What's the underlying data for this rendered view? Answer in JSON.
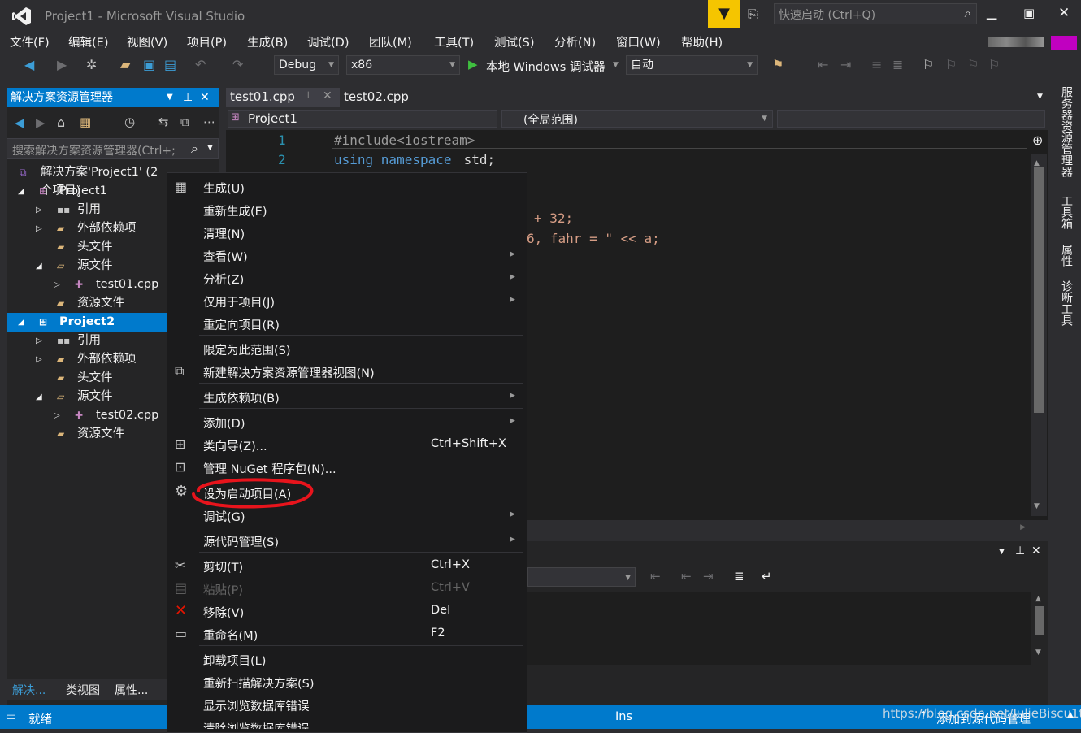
{
  "window": {
    "title": "Project1 - Microsoft Visual Studio",
    "quick_launch": "快速启动 (Ctrl+Q)"
  },
  "menu": [
    "文件(F)",
    "编辑(E)",
    "视图(V)",
    "项目(P)",
    "生成(B)",
    "调试(D)",
    "团队(M)",
    "工具(T)",
    "测试(S)",
    "分析(N)",
    "窗口(W)",
    "帮助(H)"
  ],
  "toolbar": {
    "config": "Debug",
    "platform": "x86",
    "debugger": "本地 Windows 调试器",
    "auto": "自动"
  },
  "solution_explorer": {
    "title": "解决方案资源管理器",
    "search_placeholder": "搜索解决方案资源管理器(Ctrl+;",
    "tree": [
      {
        "label": "解决方案'Project1' (2 个项目)"
      },
      {
        "label": "Project1"
      },
      {
        "label": "引用"
      },
      {
        "label": "外部依赖项"
      },
      {
        "label": "头文件"
      },
      {
        "label": "源文件"
      },
      {
        "label": "test01.cpp"
      },
      {
        "label": "资源文件"
      },
      {
        "label": "Project2"
      },
      {
        "label": "引用"
      },
      {
        "label": "外部依赖项"
      },
      {
        "label": "头文件"
      },
      {
        "label": "源文件"
      },
      {
        "label": "test02.cpp"
      },
      {
        "label": "资源文件"
      }
    ],
    "bottom_tabs": [
      "解决...",
      "类视图",
      "属性..."
    ]
  },
  "editor": {
    "tabs": [
      "test01.cpp",
      "test02.cpp"
    ],
    "nav_project": "Project1",
    "nav_scope": "(全局范围)",
    "line_numbers": [
      "1",
      "2"
    ],
    "line1": "#include<iostream>",
    "line2_kw": "using namespace",
    "line2_rest": " std;",
    "frag1": "+ 32;",
    "frag2": "6, fahr = \" << a;"
  },
  "context_menu": {
    "items": [
      {
        "label": "生成(U)"
      },
      {
        "label": "重新生成(E)"
      },
      {
        "label": "清理(N)"
      },
      {
        "label": "查看(W)"
      },
      {
        "label": "分析(Z)"
      },
      {
        "label": "仅用于项目(J)"
      },
      {
        "label": "重定向项目(R)"
      },
      {
        "label": "限定为此范围(S)"
      },
      {
        "label": "新建解决方案资源管理器视图(N)"
      },
      {
        "label": "生成依赖项(B)"
      },
      {
        "label": "添加(D)"
      },
      {
        "label": "类向导(Z)...",
        "shortcut": "Ctrl+Shift+X"
      },
      {
        "label": "管理 NuGet 程序包(N)..."
      },
      {
        "label": "设为启动项目(A)"
      },
      {
        "label": "调试(G)"
      },
      {
        "label": "源代码管理(S)"
      },
      {
        "label": "剪切(T)",
        "shortcut": "Ctrl+X"
      },
      {
        "label": "粘贴(P)",
        "shortcut": "Ctrl+V"
      },
      {
        "label": "移除(V)",
        "shortcut": "Del"
      },
      {
        "label": "重命名(M)",
        "shortcut": "F2"
      },
      {
        "label": "卸载项目(L)"
      },
      {
        "label": "重新扫描解决方案(S)"
      },
      {
        "label": "显示浏览数据库错误"
      },
      {
        "label": "清除浏览数据库错误"
      }
    ]
  },
  "right_tabs": [
    "服务器资源管理器",
    "工具箱",
    "属性",
    "诊断工具"
  ],
  "status": {
    "ready": "就绪",
    "ins": "Ins",
    "source_control": "添加到源代码管理",
    "watermark": "https://blog.csdn.net/JulieBiscu1t"
  },
  "colors": {
    "accent": "#007acc",
    "background": "#2d2d30",
    "annotation": "#e8141c"
  }
}
